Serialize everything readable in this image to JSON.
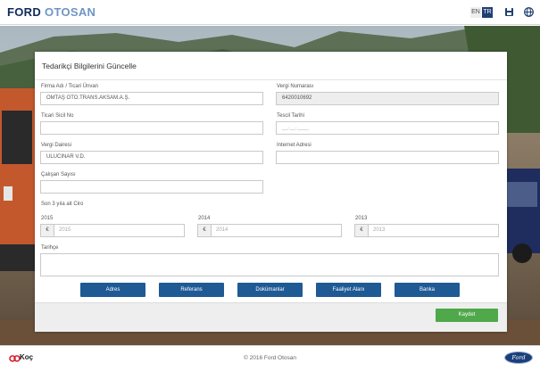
{
  "header": {
    "logo_primary": "FORD",
    "logo_secondary": "OTOSAN",
    "lang_en": "EN",
    "lang_tr": "TR",
    "icons": [
      "save-icon",
      "globe-icon"
    ]
  },
  "form": {
    "title": "Tedarikçi Bilgilerini Güncelle",
    "fields": {
      "company_name": {
        "label": "Firma Adı / Ticari Ünvan",
        "value": "OMTAŞ OTO.TRANS.AKSAM.A.Ş."
      },
      "tax_number": {
        "label": "Vergi Numarası",
        "value": "6420010692"
      },
      "trade_registry_no": {
        "label": "Ticari Sicil No",
        "value": ""
      },
      "registration_date": {
        "label": "Tescil Tarihi",
        "value": "__.__.____"
      },
      "tax_office": {
        "label": "Vergi Dairesi",
        "value": "ULUCINAR V.D."
      },
      "website": {
        "label": "Internet Adresi",
        "value": ""
      },
      "employee_count": {
        "label": "Çalışan Sayısı",
        "value": ""
      }
    },
    "revenue": {
      "label": "Son 3 yıla ait Ciro",
      "currency_symbol": "€",
      "years": [
        {
          "label": "2015",
          "placeholder": "2015"
        },
        {
          "label": "2014",
          "placeholder": "2014"
        },
        {
          "label": "2013",
          "placeholder": "2013"
        }
      ]
    },
    "history": {
      "label": "Tarihçe",
      "value": ""
    },
    "tab_buttons": [
      "Adres",
      "Referans",
      "Dokümanlar",
      "Faaliyet Alanı",
      "Banka"
    ],
    "save_label": "Kaydet"
  },
  "footer": {
    "koc_label": "Koç",
    "copyright": "© 2016 Ford Otosan",
    "ford_badge": "Ford"
  },
  "colors": {
    "brand_navy": "#0f2a5c",
    "button_blue": "#1f5a95",
    "save_green": "#4fa84a"
  }
}
